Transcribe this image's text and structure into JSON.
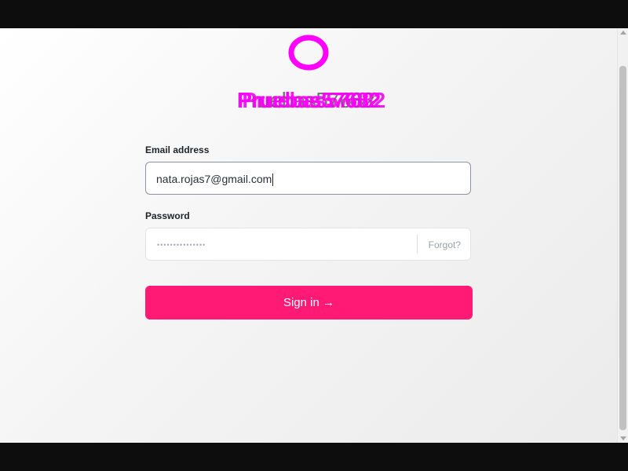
{
  "brand": {
    "name": "Pruebas57682",
    "overlay_text_1": "Pruebas57682",
    "overlay_text_2": "Pruebas57682",
    "accent_color": "#ff00ff"
  },
  "form": {
    "email_label": "Email address",
    "email_value": "nata.rojas7@gmail.com",
    "password_label": "Password",
    "password_mask": "•••••••••••••••",
    "forgot_label": "Forgot?",
    "submit_label": "Sign in →",
    "submit_color": "#ff1a75"
  },
  "icons": {
    "logo": "circle-logo-icon"
  }
}
